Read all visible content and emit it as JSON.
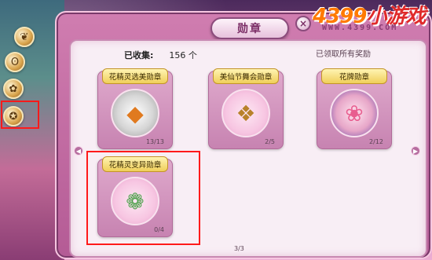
{
  "window": {
    "title": "勋章",
    "close": "×"
  },
  "logo": {
    "brand_number": "4399",
    "brand_text": "小游戏",
    "url": "WWW.4399.COM"
  },
  "summary": {
    "collected_label": "已收集:",
    "collected_value": "156 个",
    "claim_all": "已领取所有奖励"
  },
  "medals": [
    {
      "name": "花精灵选美勋章",
      "progress": "13/13",
      "icon": "peacock-egg-icon"
    },
    {
      "name": "美仙节舞会勋章",
      "progress": "2/5",
      "icon": "golden-wing-icon"
    },
    {
      "name": "花牌勋章",
      "progress": "2/12",
      "icon": "rose-wreath-icon"
    },
    {
      "name": "花精灵变异勋章",
      "progress": "0/4",
      "icon": "flower-globe-icon"
    }
  ],
  "pagination": {
    "indicator": "3/3",
    "prev": "◀",
    "next": "▶"
  },
  "side_menu": [
    {
      "icon": "leaf-icon"
    },
    {
      "icon": "bear-icon"
    },
    {
      "icon": "fox-icon"
    },
    {
      "icon": "medal-icon"
    }
  ],
  "colors": {
    "highlight": "#ff1a1a",
    "panel_bg": "#f8eef5",
    "frame": "#b45b95",
    "badge_gold": "#f0cf5a"
  }
}
